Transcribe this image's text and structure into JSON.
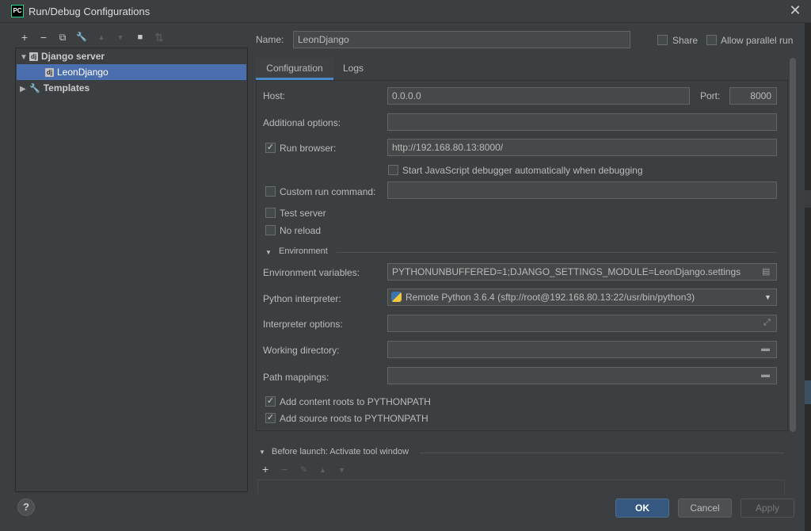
{
  "window": {
    "title": "Run/Debug Configurations",
    "logo_text": "PC"
  },
  "left_toolbar": {
    "icons": [
      "add-icon",
      "remove-icon",
      "copy-icon",
      "wrench-icon",
      "move-up-icon",
      "move-down-icon",
      "folder-add-icon",
      "sort-icon"
    ],
    "add": "+",
    "remove": "−",
    "copy": "⧉",
    "edit": "🔧",
    "up": "▲",
    "down": "▼",
    "folder": "■",
    "sort": "⇅"
  },
  "tree": {
    "group": "Django server",
    "item": "LeonDjango",
    "templates": "Templates"
  },
  "header": {
    "name_label": "Name:",
    "name_value": "LeonDjango",
    "share_label": "Share",
    "parallel_label": "Allow parallel run"
  },
  "tabs": [
    "Configuration",
    "Logs"
  ],
  "form": {
    "host_label": "Host:",
    "host_value": "0.0.0.0",
    "port_label": "Port:",
    "port_value": "8000",
    "additional_label": "Additional options:",
    "additional_value": "",
    "run_browser_label": "Run browser:",
    "run_browser_value": "http://192.168.80.13:8000/",
    "js_debugger_label": "Start JavaScript debugger automatically when debugging",
    "custom_run_label": "Custom run command:",
    "test_server_label": "Test server",
    "no_reload_label": "No reload",
    "environment_section": "Environment",
    "env_vars_label": "Environment variables:",
    "env_vars_value": "PYTHONUNBUFFERED=1;DJANGO_SETTINGS_MODULE=LeonDjango.settings",
    "interpreter_label": "Python interpreter:",
    "interpreter_value": "Remote Python 3.6.4 (sftp://root@192.168.80.13:22/usr/bin/python3)",
    "interpreter_options_label": "Interpreter options:",
    "working_dir_label": "Working directory:",
    "path_mappings_label": "Path mappings:",
    "content_roots_label": "Add content roots to PYTHONPATH",
    "source_roots_label": "Add source roots to PYTHONPATH"
  },
  "checks": {
    "share": false,
    "parallel": false,
    "run_browser": true,
    "js_debugger": false,
    "custom_run": false,
    "test_server": false,
    "no_reload": false,
    "content_roots": true,
    "source_roots": true
  },
  "before_launch": {
    "title": "Before launch: Activate tool window",
    "add": "+",
    "remove": "−",
    "edit": "✎",
    "up": "▲",
    "down": "▼"
  },
  "buttons": {
    "ok": "OK",
    "cancel": "Cancel",
    "apply": "Apply",
    "help": "?"
  },
  "colors": {
    "accent": "#4a88c7",
    "selection": "#4b6eaf",
    "primary_button": "#365880"
  }
}
